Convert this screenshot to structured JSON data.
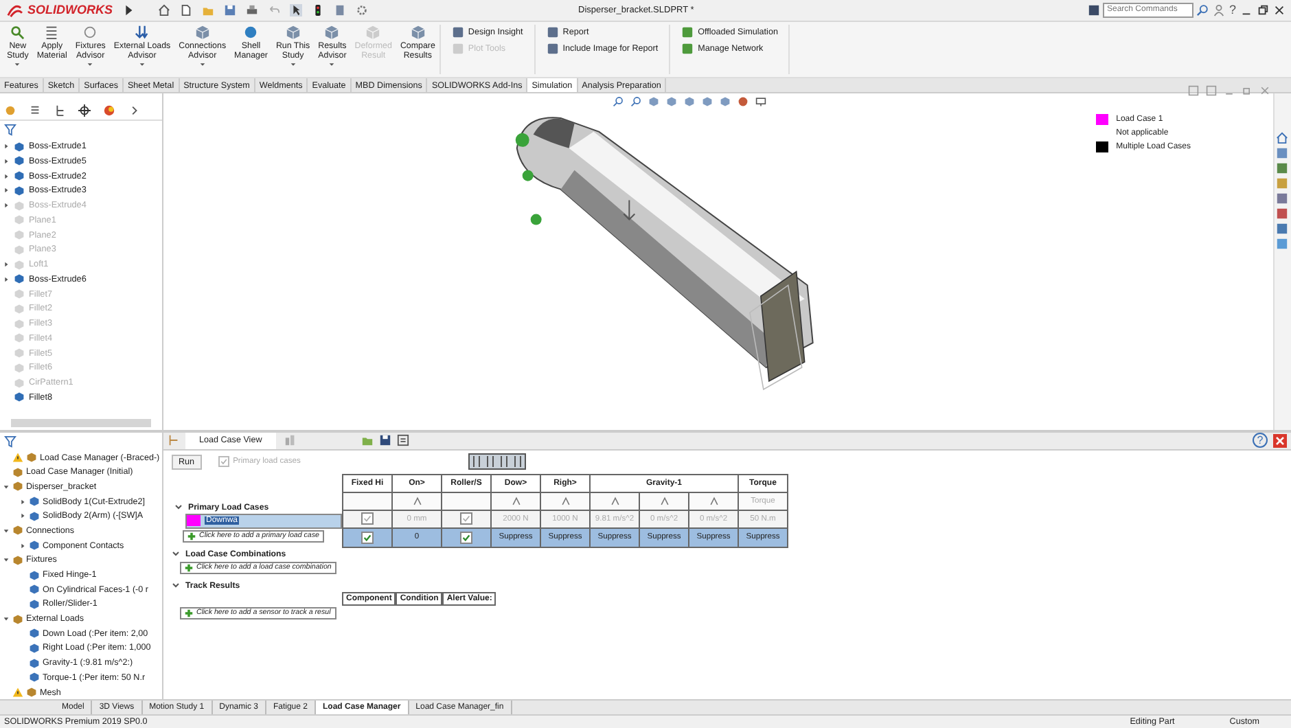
{
  "title_bar": {
    "brand": "SOLIDWORKS",
    "document_title": "Disperser_bracket.SLDPRT *",
    "search": {
      "placeholder": "Search Commands"
    },
    "help": "?"
  },
  "ribbon": {
    "large": [
      {
        "label": "New\nStudy",
        "disabled": false,
        "dropdown": true
      },
      {
        "label": "Apply\nMaterial",
        "disabled": false,
        "dropdown": false
      },
      {
        "label": "Fixtures\nAdvisor",
        "disabled": false,
        "dropdown": true
      },
      {
        "label": "External Loads\nAdvisor",
        "disabled": false,
        "dropdown": true
      },
      {
        "label": "Connections\nAdvisor",
        "disabled": false,
        "dropdown": true
      },
      {
        "label": "Shell\nManager",
        "disabled": false,
        "dropdown": false
      },
      {
        "label": "Run This\nStudy",
        "disabled": false,
        "dropdown": true
      },
      {
        "label": "Results\nAdvisor",
        "disabled": false,
        "dropdown": true
      },
      {
        "label": "Deformed\nResult",
        "disabled": true,
        "dropdown": false
      },
      {
        "label": "Compare\nResults",
        "disabled": false,
        "dropdown": false
      }
    ],
    "small_groups": [
      [
        {
          "label": "Design Insight",
          "disabled": false
        },
        {
          "label": "Plot Tools",
          "disabled": true
        }
      ],
      [
        {
          "label": "Report",
          "disabled": false
        },
        {
          "label": "Include Image for Report",
          "disabled": false
        }
      ],
      [
        {
          "label": "Offloaded Simulation",
          "disabled": false
        },
        {
          "label": "Manage Network",
          "disabled": false
        }
      ]
    ]
  },
  "command_tabs": [
    {
      "label": "Features",
      "selected": false
    },
    {
      "label": "Sketch",
      "selected": false
    },
    {
      "label": "Surfaces",
      "selected": false
    },
    {
      "label": "Sheet Metal",
      "selected": false
    },
    {
      "label": "Structure System",
      "selected": false
    },
    {
      "label": "Weldments",
      "selected": false
    },
    {
      "label": "Evaluate",
      "selected": false
    },
    {
      "label": "MBD Dimensions",
      "selected": false
    },
    {
      "label": "SOLIDWORKS Add-Ins",
      "selected": false
    },
    {
      "label": "Simulation",
      "selected": true
    },
    {
      "label": "Analysis Preparation",
      "selected": false
    }
  ],
  "feature_tree": [
    {
      "label": "Boss-Extrude1",
      "suppressed": false,
      "expandable": true
    },
    {
      "label": "Boss-Extrude5",
      "suppressed": false,
      "expandable": true
    },
    {
      "label": "Boss-Extrude2",
      "suppressed": false,
      "expandable": true
    },
    {
      "label": "Boss-Extrude3",
      "suppressed": false,
      "expandable": true
    },
    {
      "label": "Boss-Extrude4",
      "suppressed": true,
      "expandable": true
    },
    {
      "label": "Plane1",
      "suppressed": true,
      "expandable": false
    },
    {
      "label": "Plane2",
      "suppressed": true,
      "expandable": false
    },
    {
      "label": "Plane3",
      "suppressed": true,
      "expandable": false
    },
    {
      "label": "Loft1",
      "suppressed": true,
      "expandable": true
    },
    {
      "label": "Boss-Extrude6",
      "suppressed": false,
      "expandable": true
    },
    {
      "label": "Fillet7",
      "suppressed": true,
      "expandable": false
    },
    {
      "label": "Fillet2",
      "suppressed": true,
      "expandable": false
    },
    {
      "label": "Fillet3",
      "suppressed": true,
      "expandable": false
    },
    {
      "label": "Fillet4",
      "suppressed": true,
      "expandable": false
    },
    {
      "label": "Fillet5",
      "suppressed": true,
      "expandable": false
    },
    {
      "label": "Fillet6",
      "suppressed": true,
      "expandable": false
    },
    {
      "label": "CirPattern1",
      "suppressed": true,
      "expandable": false
    },
    {
      "label": "Fillet8",
      "suppressed": false,
      "expandable": false
    }
  ],
  "legend": [
    {
      "label": "Load Case 1",
      "color": "#ff00ff"
    },
    {
      "label": "Not applicable"
    },
    {
      "label": "Multiple Load Cases",
      "color": "#000000"
    }
  ],
  "sim_tree": [
    {
      "label": "Load Case Manager (-Braced-)",
      "warning": true,
      "expandable": false
    },
    {
      "label": "Load Case Manager (Initial)",
      "warning": false,
      "expandable": false
    },
    {
      "label": "Disperser_bracket",
      "warning": false,
      "expandable": true,
      "expanded": true,
      "children": [
        {
          "label": "SolidBody 1(Cut-Extrude2]",
          "warning": false,
          "expandable": true,
          "expanded": false
        },
        {
          "label": "SolidBody 2(Arm) (-[SW]A",
          "warning": false,
          "expandable": true,
          "expanded": false
        }
      ]
    },
    {
      "label": "Connections",
      "warning": false,
      "expandable": true,
      "expanded": true,
      "children": [
        {
          "label": "Component Contacts",
          "warning": false,
          "expandable": true,
          "expanded": false
        }
      ]
    },
    {
      "label": "Fixtures",
      "warning": false,
      "expandable": true,
      "expanded": true,
      "children": [
        {
          "label": "Fixed Hinge-1",
          "warning": false,
          "expandable": false
        },
        {
          "label": "On Cylindrical Faces-1 (-0 r",
          "warning": false,
          "expandable": false
        },
        {
          "label": "Roller/Slider-1",
          "warning": false,
          "expandable": false
        }
      ]
    },
    {
      "label": "External Loads",
      "warning": false,
      "expandable": true,
      "expanded": true,
      "children": [
        {
          "label": "Down Load (:Per item: 2,00",
          "warning": false,
          "expandable": false
        },
        {
          "label": "Right Load (:Per item: 1,000",
          "warning": false,
          "expandable": false
        },
        {
          "label": "Gravity-1 (:9.81 m/s^2:)",
          "warning": false,
          "expandable": false
        },
        {
          "label": "Torque-1 (:Per item: 50 N.r",
          "warning": false,
          "expandable": false
        }
      ]
    },
    {
      "label": "Mesh",
      "warning": true,
      "expandable": false
    }
  ],
  "load_case_panel": {
    "tabs": [
      {
        "label": "Load Case View",
        "selected": true
      }
    ],
    "run_button": "Run",
    "primary_checkbox": {
      "label": "Primary load cases",
      "checked": true,
      "disabled": true
    },
    "sections": [
      {
        "title": "Primary Load Cases",
        "expanded": true,
        "add_hint": "Click here to add a primary load case"
      },
      {
        "title": "Load Case Combinations",
        "expanded": true,
        "add_hint": "Click here to add a load case combination"
      },
      {
        "title": "Track Results",
        "expanded": true,
        "add_hint": "Click here to add a sensor to track a resul"
      }
    ],
    "table": {
      "columns": [
        {
          "label": "Fixed Hi",
          "sub": [
            {
              "kind": "blank"
            }
          ]
        },
        {
          "label": "On",
          "more": ">",
          "sub": [
            {
              "kind": "icon"
            }
          ]
        },
        {
          "label": "Roller/S",
          "sub": [
            {
              "kind": "blank"
            }
          ]
        },
        {
          "label": "Dow",
          "more": ">",
          "sub": [
            {
              "kind": "icon"
            }
          ]
        },
        {
          "label": "Righ",
          "more": ">",
          "sub": [
            {
              "kind": "icon"
            }
          ]
        },
        {
          "label": "Gravity-1",
          "sub": [
            {
              "kind": "icon"
            },
            {
              "kind": "icon"
            },
            {
              "kind": "icon"
            }
          ]
        },
        {
          "label": "Torque",
          "sub": [
            {
              "kind": "text",
              "text": "Torque"
            }
          ]
        }
      ],
      "baseline": {
        "disabled": true,
        "cells": [
          {
            "kind": "check",
            "checked": true
          },
          {
            "kind": "text",
            "text": "0 mm"
          },
          {
            "kind": "check",
            "checked": true
          },
          {
            "kind": "text",
            "text": "2000 N"
          },
          {
            "kind": "text",
            "text": "1000 N"
          },
          {
            "kind": "text",
            "text": "9.81 m/s^2"
          },
          {
            "kind": "text",
            "text": "0 m/s^2"
          },
          {
            "kind": "text",
            "text": "0 m/s^2"
          },
          {
            "kind": "text",
            "text": "50 N.m"
          }
        ]
      },
      "load_cases": [
        {
          "name": "Downwa",
          "color": "#ff00ff",
          "selected": true,
          "cells": [
            {
              "kind": "check",
              "checked": true
            },
            {
              "kind": "text",
              "text": "0"
            },
            {
              "kind": "check",
              "checked": true
            },
            {
              "kind": "text",
              "text": "Suppress"
            },
            {
              "kind": "text",
              "text": "Suppress"
            },
            {
              "kind": "text",
              "text": "Suppress"
            },
            {
              "kind": "text",
              "text": "Suppress"
            },
            {
              "kind": "text",
              "text": "Suppress"
            },
            {
              "kind": "text",
              "text": "Suppress"
            }
          ]
        }
      ]
    },
    "results_columns": [
      "Component",
      "Condition",
      "Alert Value:"
    ]
  },
  "bottom_tabs": [
    {
      "label": "Model",
      "selected": false
    },
    {
      "label": "3D Views",
      "selected": false
    },
    {
      "label": "Motion Study 1",
      "selected": false
    },
    {
      "label": "Dynamic 3",
      "selected": false
    },
    {
      "label": "Fatigue 2",
      "selected": false
    },
    {
      "label": "Load Case Manager",
      "selected": true
    },
    {
      "label": "Load Case Manager_fin",
      "selected": false
    }
  ],
  "status_bar": {
    "product": "SOLIDWORKS Premium 2019 SP0.0",
    "mode": "Editing Part",
    "units": "Custom"
  }
}
